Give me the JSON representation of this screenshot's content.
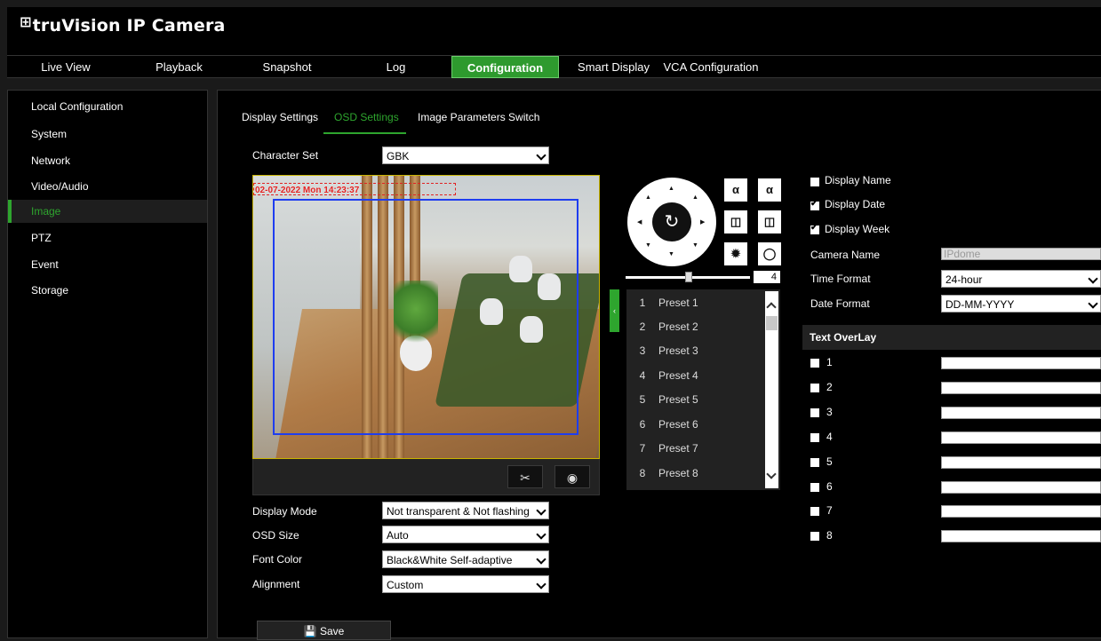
{
  "app": {
    "title": "truVision IP Camera"
  },
  "nav": [
    "Live View",
    "Playback",
    "Snapshot",
    "Log",
    "Configuration",
    "Smart Display",
    "VCA Configuration"
  ],
  "sidebar": [
    "Local Configuration",
    "System",
    "Network",
    "Video/Audio",
    "Image",
    "PTZ",
    "Event",
    "Storage"
  ],
  "tabs": [
    "Display Settings",
    "OSD Settings",
    "Image Parameters Switch"
  ],
  "form": {
    "character_set_label": "Character Set",
    "character_set_value": "GBK",
    "display_mode_label": "Display Mode",
    "display_mode_value": "Not transparent & Not flashing",
    "osd_size_label": "OSD Size",
    "osd_size_value": "Auto",
    "font_color_label": "Font Color",
    "font_color_value": "Black&White Self-adaptive",
    "alignment_label": "Alignment",
    "alignment_value": "Custom",
    "save_label": "Save"
  },
  "video": {
    "osd_text": "02-07-2022 Mon 14:23:37"
  },
  "ptz": {
    "speed": "4"
  },
  "presets": [
    {
      "num": "1",
      "name": "Preset 1"
    },
    {
      "num": "2",
      "name": "Preset 2"
    },
    {
      "num": "3",
      "name": "Preset 3"
    },
    {
      "num": "4",
      "name": "Preset 4"
    },
    {
      "num": "5",
      "name": "Preset 5"
    },
    {
      "num": "6",
      "name": "Preset 6"
    },
    {
      "num": "7",
      "name": "Preset 7"
    },
    {
      "num": "8",
      "name": "Preset 8"
    }
  ],
  "osd": {
    "display_name_label": "Display Name",
    "display_name_checked": false,
    "display_date_label": "Display Date",
    "display_date_checked": true,
    "display_week_label": "Display Week",
    "display_week_checked": true,
    "camera_name_label": "Camera Name",
    "camera_name_value": "IPdome",
    "time_format_label": "Time Format",
    "time_format_value": "24-hour",
    "date_format_label": "Date Format",
    "date_format_value": "DD-MM-YYYY",
    "text_overlay_header": "Text OverLay",
    "overlay_items": [
      "1",
      "2",
      "3",
      "4",
      "5",
      "6",
      "7",
      "8"
    ]
  },
  "colors": {
    "accent": "#2ea52e",
    "background": "#000000"
  }
}
